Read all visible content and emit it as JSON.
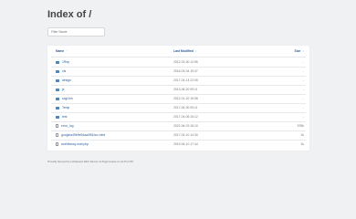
{
  "page_title": "Index of /",
  "filter": {
    "placeholder": "Filter Name"
  },
  "columns": {
    "name": "Name",
    "last_modified": "Last Modified",
    "size": "Size",
    "name_sort": "↑",
    "mod_sort": "↕",
    "size_sort": "↕"
  },
  "rows": [
    {
      "name": "1Rep",
      "type": "folder",
      "modified": "2012-03-30 12:56",
      "size": "-"
    },
    {
      "name": "cls",
      "type": "folder",
      "modified": "2016-03-04 19:37",
      "size": "-"
    },
    {
      "name": "design",
      "type": "folder",
      "modified": "2017-04-14 22:05",
      "size": "-"
    },
    {
      "name": "js",
      "type": "folder",
      "modified": "2013-06-20 09:11",
      "size": "-"
    },
    {
      "name": "scgi-bin",
      "type": "folder",
      "modified": "2012-01-20 15:58",
      "size": "-"
    },
    {
      "name": "Temp",
      "type": "folder",
      "modified": "2017-06-30 09:11",
      "size": "-"
    },
    {
      "name": "test",
      "type": "folder",
      "modified": "2017-04-06 15:12",
      "size": "-"
    },
    {
      "name": "error_log",
      "type": "file",
      "modified": "2022-06-03 15:10",
      "size": "978k"
    },
    {
      "name": "googlea49b9e54aa0f51bcc.html",
      "type": "file",
      "modified": "2017-04-10 14:30",
      "size": "1k"
    },
    {
      "name": "worldfancy-mail.php",
      "type": "file",
      "modified": "2019-06-10 17:44",
      "size": "1k"
    }
  ],
  "footer": "Proudly Served by LiteSpeed Web Server at bbgcmoaue.co.za Port 80"
}
